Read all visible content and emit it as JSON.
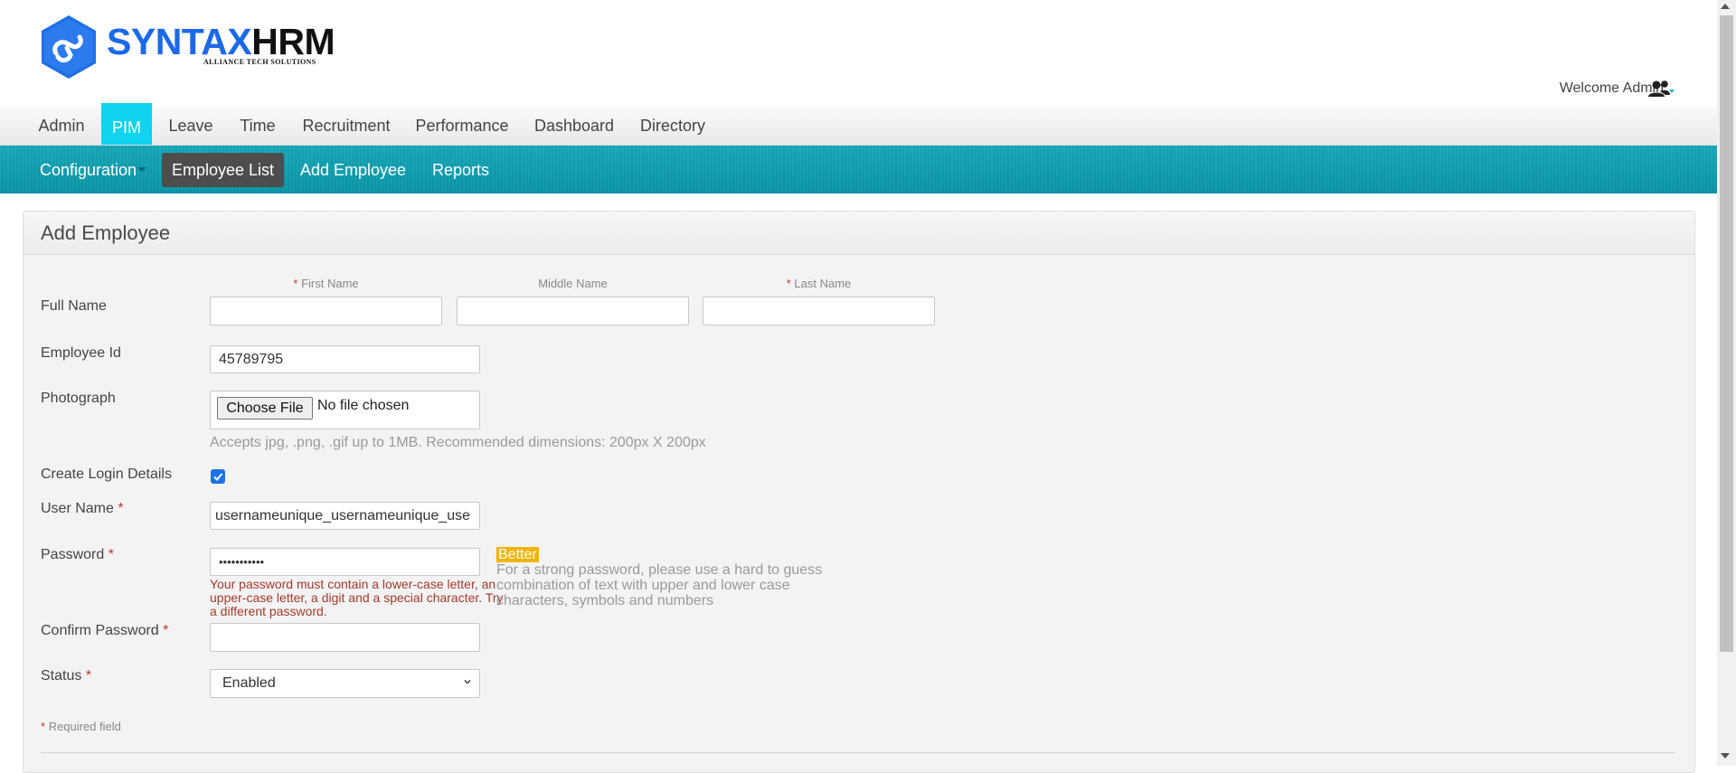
{
  "header": {
    "logo_main": "SYNTAX",
    "logo_accent": "HRM",
    "logo_sub": "ALLIANCE TECH SOLUTIONS",
    "welcome": "Welcome Admin",
    "user_icon": "users-icon"
  },
  "topnav": {
    "items": [
      {
        "label": "Admin",
        "active": false
      },
      {
        "label": "PIM",
        "active": true
      },
      {
        "label": "Leave",
        "active": false
      },
      {
        "label": "Time",
        "active": false
      },
      {
        "label": "Recruitment",
        "active": false
      },
      {
        "label": "Performance",
        "active": false
      },
      {
        "label": "Dashboard",
        "active": false
      },
      {
        "label": "Directory",
        "active": false
      }
    ]
  },
  "subnav": {
    "items": [
      {
        "label": "Configuration",
        "active": false
      },
      {
        "label": "Employee List",
        "active": true
      },
      {
        "label": "Add Employee",
        "active": false
      },
      {
        "label": "Reports",
        "active": false
      }
    ]
  },
  "form": {
    "title": "Add Employee",
    "full_name": {
      "label": "Full Name",
      "first_label": "First Name",
      "middle_label": "Middle Name",
      "last_label": "Last Name",
      "first_value": "",
      "middle_value": "",
      "last_value": ""
    },
    "employee_id": {
      "label": "Employee Id",
      "value": "45789795"
    },
    "photograph": {
      "label": "Photograph",
      "button": "Choose File",
      "file_status": "No file chosen",
      "hint": "Accepts jpg, .png, .gif up to 1MB. Recommended dimensions: 200px X 200px"
    },
    "create_login": {
      "label": "Create Login Details",
      "checked": true
    },
    "username": {
      "label": "User Name",
      "value": "usernameunique_usernameunique_use"
    },
    "password": {
      "label": "Password",
      "value": "•••••••••••",
      "error": "Your password must contain a lower-case letter, an upper-case letter, a digit and a special character. Try a different password.",
      "strength": "Better",
      "help": "For a strong password, please use a hard to guess combination of text with upper and lower case characters, symbols and numbers"
    },
    "confirm_password": {
      "label": "Confirm Password",
      "value": ""
    },
    "status": {
      "label": "Status",
      "selected": "Enabled"
    },
    "required_marker": "*",
    "required_note": "Required field"
  },
  "colors": {
    "accent": "#0fd3ef",
    "subnav_bg": "#10a3b5",
    "active_sub": "#4d4d4d",
    "error": "#a33b2c",
    "strength": "#f0b400"
  }
}
